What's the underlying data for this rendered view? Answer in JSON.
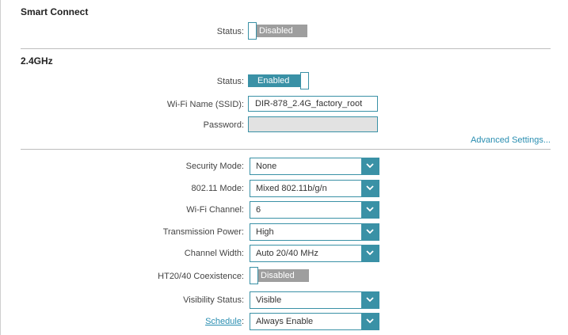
{
  "smart_connect": {
    "title": "Smart Connect",
    "status_label": "Status:",
    "status_value": "Disabled"
  },
  "band_24": {
    "title": "2.4GHz",
    "status_label": "Status:",
    "status_value": "Enabled",
    "ssid_label": "Wi-Fi Name (SSID):",
    "ssid_value": "DIR-878_2.4G_factory_root",
    "password_label": "Password:",
    "password_value": "",
    "advanced_link": "Advanced Settings..."
  },
  "advanced": {
    "security_mode_label": "Security Mode:",
    "security_mode_value": "None",
    "mode_80211_label": "802.11 Mode:",
    "mode_80211_value": "Mixed 802.11b/g/n",
    "channel_label": "Wi-Fi Channel:",
    "channel_value": "6",
    "tx_power_label": "Transmission Power:",
    "tx_power_value": "High",
    "width_label": "Channel Width:",
    "width_value": "Auto 20/40 MHz",
    "coexist_label": "HT20/40 Coexistence:",
    "coexist_value": "Disabled",
    "visibility_label": "Visibility Status:",
    "visibility_value": "Visible",
    "schedule_label": "Schedule",
    "schedule_colon": ":",
    "schedule_value": "Always Enable"
  },
  "colors": {
    "accent": "#3a91a6",
    "toggle_off": "#9e9e9e",
    "link": "#2a8eb1"
  }
}
